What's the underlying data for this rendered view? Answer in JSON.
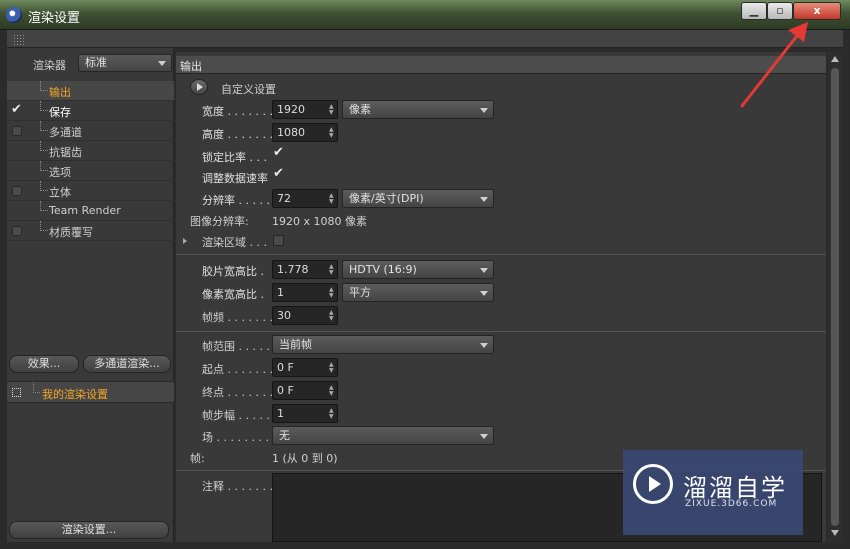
{
  "window": {
    "title": "渲染设置",
    "minimize": "▁",
    "maximize": "▫",
    "close": "x"
  },
  "left": {
    "renderer_label": "渲染器",
    "renderer_value": "标准",
    "tree": [
      {
        "label": "输出",
        "checked": null,
        "state": "active"
      },
      {
        "label": "保存",
        "checked": true,
        "state": "white"
      },
      {
        "label": "多通道",
        "checked": false,
        "state": ""
      },
      {
        "label": "抗锯齿",
        "checked": null,
        "state": ""
      },
      {
        "label": "选项",
        "checked": null,
        "state": ""
      },
      {
        "label": "立体",
        "checked": false,
        "state": ""
      },
      {
        "label": "Team Render",
        "checked": null,
        "state": ""
      },
      {
        "label": "材质覆写",
        "checked": false,
        "state": ""
      }
    ],
    "effects_button": "效果...",
    "multipass_button": "多通道渲染...",
    "preset_label": "我的渲染设置",
    "render_settings_button": "渲染设置..."
  },
  "output": {
    "section_title": "输出",
    "preset_label": "自定义设置",
    "width_label": "宽度 . . . . . . .",
    "width_value": "1920",
    "width_unit": "像素",
    "height_label": "高度 . . . . . . .",
    "height_value": "1080",
    "lock_ratio_label": "锁定比率 . . .",
    "adapt_rate_label": "调整数据速率",
    "resolution_label": "分辨率 . . . . .",
    "resolution_value": "72",
    "resolution_unit": "像素/英寸(DPI)",
    "image_res_label": "图像分辨率:",
    "image_res_value": "1920 x 1080 像素",
    "render_region_label": "渲染区域 . . .",
    "film_aspect_label": "胶片宽高比 .",
    "film_aspect_value": "1.778",
    "film_aspect_preset": "HDTV (16:9)",
    "pixel_aspect_label": "像素宽高比 .",
    "pixel_aspect_value": "1",
    "pixel_aspect_preset": "平方",
    "framerate_label": "帧频 . . . . . . .",
    "framerate_value": "30",
    "frame_range_label": "帧范围 . . . . .",
    "frame_range_value": "当前帧",
    "start_label": "起点 . . . . . . .",
    "start_value": "0 F",
    "end_label": "终点 . . . . . . .",
    "end_value": "0 F",
    "step_label": "帧步幅 . . . . .",
    "step_value": "1",
    "field_label": "场 . . . . . . . . .",
    "field_value": "无",
    "frames_label": "帧:",
    "frames_value": "1 (从 0 到 0)",
    "notes_label": "注释 . . . . . . ."
  },
  "watermark": {
    "title": "溜溜自学",
    "subtitle": "ZIXUE.3D66.COM"
  },
  "colors": {
    "accent_orange": "#f5a623",
    "annotation_red": "#e53935",
    "watermark_bg": "#3a4873"
  }
}
